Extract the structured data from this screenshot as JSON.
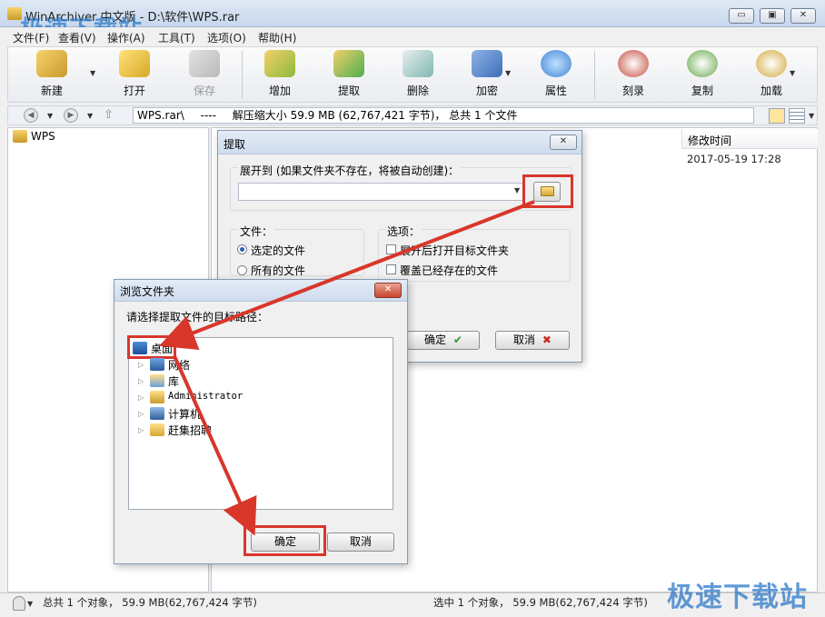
{
  "window": {
    "title": "WinArchiver 中文版 - D:\\软件\\WPS.rar",
    "watermark": "极速下载站",
    "minimize": "▭",
    "maximize": "▣",
    "close": "✕"
  },
  "menu": [
    "文件(F)",
    "查看(V)",
    "操作(A)",
    "工具(T)",
    "选项(O)",
    "帮助(H)"
  ],
  "toolbar": {
    "new": "新建",
    "open": "打开",
    "save": "保存",
    "add": "增加",
    "extract": "提取",
    "delete": "删除",
    "encrypt": "加密",
    "properties": "属性",
    "burn": "刻录",
    "copy": "复制",
    "mount": "加载"
  },
  "address": {
    "path": "WPS.rar\\",
    "dashes": "----",
    "info": "解压缩大小 59.9 MB (62,767,421 字节)， 总共 1 个文件"
  },
  "tree": {
    "root": "WPS"
  },
  "list": {
    "column_modified": "修改时间",
    "row_modified": "2017-05-19 17:28"
  },
  "status": {
    "left": "总共 1 个对象， 59.9 MB(62,767,424 字节)",
    "right": "选中 1 个对象， 59.9 MB(62,767,424 字节)"
  },
  "extract_dialog": {
    "title": "提取",
    "expand_to_label": "展开到 (如果文件夹不存在，将被自动创建)：",
    "path_value": "",
    "files_label": "文件：",
    "selected_files": "选定的文件",
    "all_files": "所有的文件",
    "options_label": "选项：",
    "open_target": "展开后打开目标文件夹",
    "overwrite": "覆盖已经存在的文件",
    "ok": "确定",
    "cancel": "取消"
  },
  "browse_dialog": {
    "title": "浏览文件夹",
    "prompt": "请选择提取文件的目标路径：",
    "items": [
      "桌面",
      "网络",
      "库",
      "Administrator",
      "计算机",
      "赶集招聘"
    ],
    "ok": "确定",
    "cancel": "取消"
  },
  "colors": {
    "highlight_red": "#d9362b",
    "watermark_blue": "#2d78c8"
  }
}
